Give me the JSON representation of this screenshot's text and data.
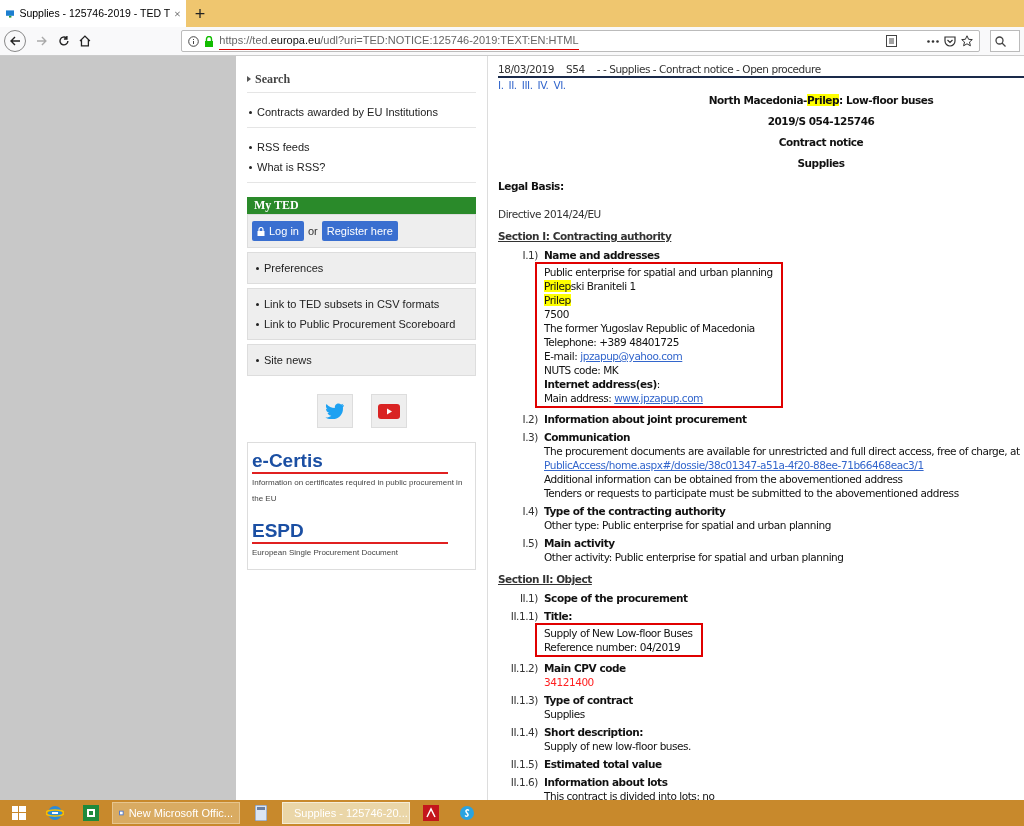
{
  "browser": {
    "tab_title": "Supplies - 125746-2019 - TED T",
    "url_host_prefix": "https://ted.",
    "url_host_domain": "europa.eu",
    "url_path": "/udl?uri=TED:NOTICE:125746-2019:TEXT:EN:HTML",
    "new_tab": "+"
  },
  "sidebar": {
    "search": "Search",
    "link_groups": [
      {
        "boxed": false,
        "links": [
          "Contracts awarded by EU Institutions"
        ]
      },
      {
        "boxed": false,
        "links": [
          "RSS feeds",
          "What is RSS?"
        ]
      }
    ],
    "my_ted": {
      "title": "My TED",
      "login": "Log in",
      "or": "or",
      "register": "Register here"
    },
    "boxes": [
      {
        "boxed": true,
        "links": [
          "Preferences"
        ]
      },
      {
        "boxed": true,
        "links": [
          "Link to TED subsets in CSV formats",
          "Link to Public Procurement Scoreboard"
        ]
      },
      {
        "boxed": true,
        "links": [
          "Site news"
        ]
      }
    ],
    "promos": [
      {
        "logo": "e-Certis",
        "caption": "Information on certificates required in public procurement in the EU"
      },
      {
        "logo": "ESPD",
        "caption": "European Single Procurement Document"
      }
    ]
  },
  "document": {
    "header": {
      "date": "18/03/2019",
      "issue": "S54",
      "type": "- - Supplies - Contract notice - Open procedure"
    },
    "nav_links": [
      "I.",
      "II.",
      "III.",
      "IV.",
      "VI."
    ],
    "title": [
      {
        "text": "North Macedonia-",
        "kind": "plain"
      },
      {
        "text": "Prilep",
        "kind": "highlight"
      },
      {
        "text": ": Low-floor buses",
        "kind": "plain"
      }
    ],
    "centered": [
      "2019/S 054-125746",
      "Contract notice",
      "Supplies"
    ],
    "legal_basis": "Legal Basis:",
    "directive": "Directive 2014/24/EU",
    "sections": [
      {
        "heading": "Section I: Contracting authority",
        "items": [
          {
            "number": "I.1)",
            "label": "Name and addresses",
            "outlined": true,
            "lines": [
              [
                {
                  "text": "Public enterprise for spatial and urban planning",
                  "kind": "plain"
                }
              ],
              [
                {
                  "text": "Prilep",
                  "kind": "highlight"
                },
                {
                  "text": "ski Braniteli 1",
                  "kind": "plain"
                }
              ],
              [
                {
                  "text": "Prilep",
                  "kind": "highlight"
                }
              ],
              [
                {
                  "text": "7500",
                  "kind": "plain"
                }
              ],
              [
                {
                  "text": "The former Yugoslav Republic of Macedonia",
                  "kind": "plain"
                }
              ],
              [
                {
                  "text": "Telephone: +389 48401725",
                  "kind": "plain"
                }
              ],
              [
                {
                  "text": "E-mail: ",
                  "kind": "plain"
                },
                {
                  "text": "jpzapup@yahoo.com",
                  "kind": "link"
                }
              ],
              [
                {
                  "text": "NUTS code: MK",
                  "kind": "plain"
                }
              ],
              [
                {
                  "text": "Internet address(es)",
                  "kind": "bold"
                },
                {
                  "text": ":",
                  "kind": "plain"
                }
              ],
              [
                {
                  "text": "Main address: ",
                  "kind": "plain"
                },
                {
                  "text": "www.jpzapup.com",
                  "kind": "link"
                }
              ]
            ]
          },
          {
            "number": "I.2)",
            "label": "Information about joint procurement",
            "outlined": false
          },
          {
            "number": "I.3)",
            "label": "Communication",
            "outlined": false,
            "lines": [
              [
                {
                  "text": "The procurement documents are available for unrestricted and full direct access, free of charge, at",
                  "kind": "plain"
                }
              ],
              [
                {
                  "text": "PublicAccess/home.aspx#/dossie/38c01347-a51a-4f20-88ee-71b66468eac3/1",
                  "kind": "link"
                }
              ],
              [
                {
                  "text": "Additional information can be obtained from the abovementioned address",
                  "kind": "plain"
                }
              ],
              [
                {
                  "text": "Tenders or requests to participate must be submitted to the abovementioned address",
                  "kind": "plain"
                }
              ]
            ]
          },
          {
            "number": "I.4)",
            "label": "Type of the contracting authority",
            "outlined": false,
            "lines": [
              [
                {
                  "text": "Other type: Public enterprise for spatial and urban planning",
                  "kind": "plain"
                }
              ]
            ]
          },
          {
            "number": "I.5)",
            "label": "Main activity",
            "outlined": false,
            "lines": [
              [
                {
                  "text": "Other activity: Public enterprise for spatial and urban planning",
                  "kind": "plain"
                }
              ]
            ]
          }
        ]
      },
      {
        "heading": "Section II: Object",
        "items": [
          {
            "number": "II.1)",
            "label": "Scope of the procurement",
            "outlined": false
          },
          {
            "number": "II.1.1)",
            "label": "Title:",
            "outlined": true,
            "lines": [
              [
                {
                  "text": "Supply of New Low-floor Buses",
                  "kind": "plain"
                }
              ],
              [
                {
                  "text": "Reference number: 04/2019",
                  "kind": "plain"
                }
              ]
            ]
          },
          {
            "number": "II.1.2)",
            "label": "Main CPV code",
            "outlined": false,
            "lines": [
              [
                {
                  "text": "34121400",
                  "kind": "code"
                }
              ]
            ]
          },
          {
            "number": "II.1.3)",
            "label": "Type of contract",
            "outlined": false,
            "lines": [
              [
                {
                  "text": "Supplies",
                  "kind": "plain"
                }
              ]
            ]
          },
          {
            "number": "II.1.4)",
            "label": "Short description:",
            "outlined": false,
            "lines": [
              [
                {
                  "text": "Supply of new low-floor buses.",
                  "kind": "plain"
                }
              ]
            ]
          },
          {
            "number": "II.1.5)",
            "label": "Estimated total value",
            "outlined": false
          },
          {
            "number": "II.1.6)",
            "label": "Information about lots",
            "outlined": false,
            "lines": [
              [
                {
                  "text": "This contract is divided into lots: no",
                  "kind": "plain"
                }
              ]
            ]
          }
        ]
      }
    ]
  },
  "taskbar": [
    {
      "kind": "start",
      "selected": false
    },
    {
      "kind": "browser-e",
      "selected": false
    },
    {
      "kind": "spreadsheet",
      "selected": false
    },
    {
      "kind": "document",
      "label": "New Microsoft Offic...",
      "selected": false
    },
    {
      "kind": "calculator",
      "selected": false
    },
    {
      "kind": "firefox",
      "label": "Supplies - 125746-20...",
      "selected": true
    },
    {
      "kind": "pdf",
      "selected": false
    },
    {
      "kind": "chat",
      "selected": false
    }
  ]
}
